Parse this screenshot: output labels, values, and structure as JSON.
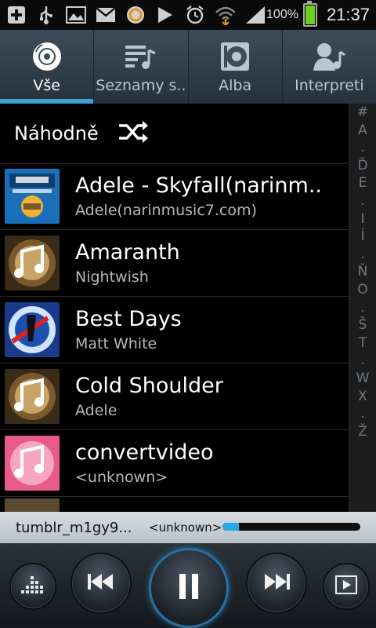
{
  "status_bar": {
    "battery_percent_label": "100%",
    "time": "21:37",
    "icons": [
      "plus-icon",
      "usb-icon",
      "image-icon",
      "gmail-icon",
      "app-circle-icon",
      "play-store-icon",
      "alarm-icon",
      "wifi-icon",
      "signal-icon",
      "battery-icon"
    ]
  },
  "tabs": [
    {
      "label": "Vše",
      "icon": "disc-icon",
      "active": true
    },
    {
      "label": "Seznamy s..",
      "icon": "playlist-icon",
      "active": false
    },
    {
      "label": "Alba",
      "icon": "album-icon",
      "active": false
    },
    {
      "label": "Interpreti",
      "icon": "artist-icon",
      "active": false
    }
  ],
  "random": {
    "label": "Náhodně",
    "icon": "shuffle-icon"
  },
  "songs": [
    {
      "title": "Adele - Skyfall(narinm..",
      "artist": "Adele(narinmusic7.com)"
    },
    {
      "title": "Amaranth",
      "artist": "Nightwish"
    },
    {
      "title": "Best Days",
      "artist": "Matt White"
    },
    {
      "title": "Cold Shoulder",
      "artist": "Adele"
    },
    {
      "title": "convertvideo",
      "artist": "<unknown>"
    }
  ],
  "index_letters": [
    "#",
    "A",
    ".",
    "Ď",
    "E",
    ".",
    "I",
    "Í",
    ".",
    "Ň",
    "O",
    ".",
    "Š",
    "T",
    ".",
    "W",
    "X",
    ".",
    "Ž"
  ],
  "now_playing": {
    "title": "tumblr_m1gy9...",
    "artist": "<unknown>",
    "progress_fraction": 0.12
  },
  "controls": [
    "equalizer-button",
    "previous-button",
    "pause-button",
    "next-button",
    "now-playing-button"
  ],
  "colors": {
    "accent": "#3fa0d6",
    "progress": "#27a9e8",
    "battery": "#6ccf1f"
  }
}
